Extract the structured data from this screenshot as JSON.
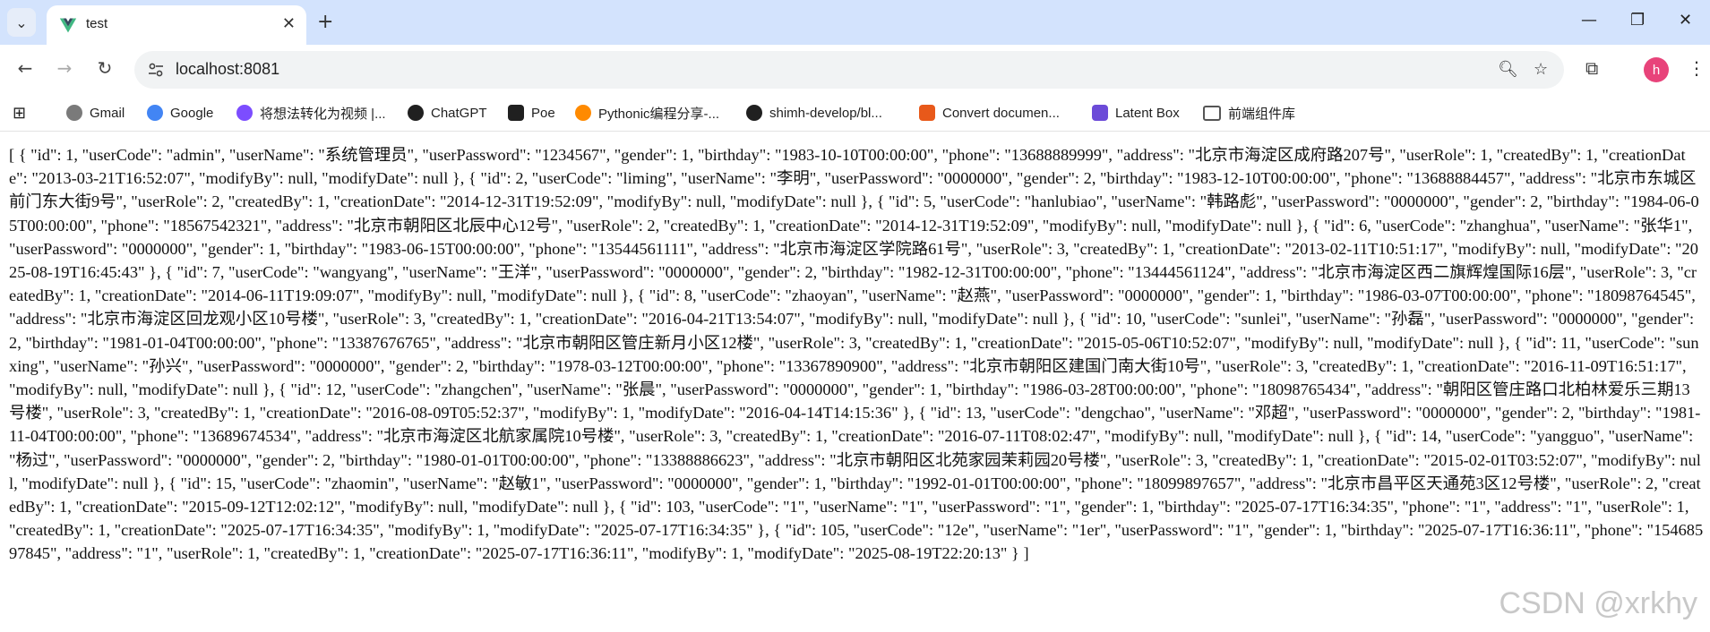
{
  "browser": {
    "tab_title": "test",
    "new_tab_glyph": "+",
    "url": "localhost:8081",
    "profile_initial": "h",
    "icons": [
      "tab-search-icon",
      "vue-logo-icon",
      "close-icon",
      "back-icon",
      "forward-icon",
      "reload-icon",
      "site-info-icon",
      "zoom-icon",
      "star-icon",
      "extensions-icon",
      "menu-icon",
      "apps-icon"
    ]
  },
  "bookmarks": [
    {
      "label": "Gmail",
      "color": "#ea4335"
    },
    {
      "label": "Google",
      "color": "#4285f4"
    },
    {
      "label": "将想法转化为视频 |...",
      "color": "#7c4dff"
    },
    {
      "label": "ChatGPT",
      "color": "#202020"
    },
    {
      "label": "Poe",
      "color": "#202020"
    },
    {
      "label": "Pythonic编程分享-...",
      "color": "#ff8a00"
    },
    {
      "label": "shimh-develop/bl...",
      "color": "#202020"
    },
    {
      "label": "Convert documen...",
      "color": "#e8591a"
    },
    {
      "label": "Latent Box",
      "color": "#6c4bd8"
    },
    {
      "label": "前端组件库",
      "color": "#666666"
    }
  ],
  "content": {
    "json_text": "[ { \"id\": 1, \"userCode\": \"admin\", \"userName\": \"系统管理员\", \"userPassword\": \"1234567\", \"gender\": 1, \"birthday\": \"1983-10-10T00:00:00\", \"phone\": \"13688889999\", \"address\": \"北京市海淀区成府路207号\", \"userRole\": 1, \"createdBy\": 1, \"creationDate\": \"2013-03-21T16:52:07\", \"modifyBy\": null, \"modifyDate\": null }, { \"id\": 2, \"userCode\": \"liming\", \"userName\": \"李明\", \"userPassword\": \"0000000\", \"gender\": 2, \"birthday\": \"1983-12-10T00:00:00\", \"phone\": \"13688884457\", \"address\": \"北京市东城区前门东大街9号\", \"userRole\": 2, \"createdBy\": 1, \"creationDate\": \"2014-12-31T19:52:09\", \"modifyBy\": null, \"modifyDate\": null }, { \"id\": 5, \"userCode\": \"hanlubiao\", \"userName\": \"韩路彪\", \"userPassword\": \"0000000\", \"gender\": 2, \"birthday\": \"1984-06-05T00:00:00\", \"phone\": \"18567542321\", \"address\": \"北京市朝阳区北辰中心12号\", \"userRole\": 2, \"createdBy\": 1, \"creationDate\": \"2014-12-31T19:52:09\", \"modifyBy\": null, \"modifyDate\": null }, { \"id\": 6, \"userCode\": \"zhanghua\", \"userName\": \"张华1\", \"userPassword\": \"0000000\", \"gender\": 1, \"birthday\": \"1983-06-15T00:00:00\", \"phone\": \"13544561111\", \"address\": \"北京市海淀区学院路61号\", \"userRole\": 3, \"createdBy\": 1, \"creationDate\": \"2013-02-11T10:51:17\", \"modifyBy\": null, \"modifyDate\": \"2025-08-19T16:45:43\" }, { \"id\": 7, \"userCode\": \"wangyang\", \"userName\": \"王洋\", \"userPassword\": \"0000000\", \"gender\": 2, \"birthday\": \"1982-12-31T00:00:00\", \"phone\": \"13444561124\", \"address\": \"北京市海淀区西二旗辉煌国际16层\", \"userRole\": 3, \"createdBy\": 1, \"creationDate\": \"2014-06-11T19:09:07\", \"modifyBy\": null, \"modifyDate\": null }, { \"id\": 8, \"userCode\": \"zhaoyan\", \"userName\": \"赵燕\", \"userPassword\": \"0000000\", \"gender\": 1, \"birthday\": \"1986-03-07T00:00:00\", \"phone\": \"18098764545\", \"address\": \"北京市海淀区回龙观小区10号楼\", \"userRole\": 3, \"createdBy\": 1, \"creationDate\": \"2016-04-21T13:54:07\", \"modifyBy\": null, \"modifyDate\": null }, { \"id\": 10, \"userCode\": \"sunlei\", \"userName\": \"孙磊\", \"userPassword\": \"0000000\", \"gender\": 2, \"birthday\": \"1981-01-04T00:00:00\", \"phone\": \"13387676765\", \"address\": \"北京市朝阳区管庄新月小区12楼\", \"userRole\": 3, \"createdBy\": 1, \"creationDate\": \"2015-05-06T10:52:07\", \"modifyBy\": null, \"modifyDate\": null }, { \"id\": 11, \"userCode\": \"sunxing\", \"userName\": \"孙兴\", \"userPassword\": \"0000000\", \"gender\": 2, \"birthday\": \"1978-03-12T00:00:00\", \"phone\": \"13367890900\", \"address\": \"北京市朝阳区建国门南大街10号\", \"userRole\": 3, \"createdBy\": 1, \"creationDate\": \"2016-11-09T16:51:17\", \"modifyBy\": null, \"modifyDate\": null }, { \"id\": 12, \"userCode\": \"zhangchen\", \"userName\": \"张晨\", \"userPassword\": \"0000000\", \"gender\": 1, \"birthday\": \"1986-03-28T00:00:00\", \"phone\": \"18098765434\", \"address\": \"朝阳区管庄路口北柏林爱乐三期13号楼\", \"userRole\": 3, \"createdBy\": 1, \"creationDate\": \"2016-08-09T05:52:37\", \"modifyBy\": 1, \"modifyDate\": \"2016-04-14T14:15:36\" }, { \"id\": 13, \"userCode\": \"dengchao\", \"userName\": \"邓超\", \"userPassword\": \"0000000\", \"gender\": 2, \"birthday\": \"1981-11-04T00:00:00\", \"phone\": \"13689674534\", \"address\": \"北京市海淀区北航家属院10号楼\", \"userRole\": 3, \"createdBy\": 1, \"creationDate\": \"2016-07-11T08:02:47\", \"modifyBy\": null, \"modifyDate\": null }, { \"id\": 14, \"userCode\": \"yangguo\", \"userName\": \"杨过\", \"userPassword\": \"0000000\", \"gender\": 2, \"birthday\": \"1980-01-01T00:00:00\", \"phone\": \"13388886623\", \"address\": \"北京市朝阳区北苑家园茉莉园20号楼\", \"userRole\": 3, \"createdBy\": 1, \"creationDate\": \"2015-02-01T03:52:07\", \"modifyBy\": null, \"modifyDate\": null }, { \"id\": 15, \"userCode\": \"zhaomin\", \"userName\": \"赵敏1\", \"userPassword\": \"0000000\", \"gender\": 1, \"birthday\": \"1992-01-01T00:00:00\", \"phone\": \"18099897657\", \"address\": \"北京市昌平区天通苑3区12号楼\", \"userRole\": 2, \"createdBy\": 1, \"creationDate\": \"2015-09-12T12:02:12\", \"modifyBy\": null, \"modifyDate\": null }, { \"id\": 103, \"userCode\": \"1\", \"userName\": \"1\", \"userPassword\": \"1\", \"gender\": 1, \"birthday\": \"2025-07-17T16:34:35\", \"phone\": \"1\", \"address\": \"1\", \"userRole\": 1, \"createdBy\": 1, \"creationDate\": \"2025-07-17T16:34:35\", \"modifyBy\": 1, \"modifyDate\": \"2025-07-17T16:34:35\" }, { \"id\": 105, \"userCode\": \"12e\", \"userName\": \"1er\", \"userPassword\": \"1\", \"gender\": 1, \"birthday\": \"2025-07-17T16:36:11\", \"phone\": \"15468597845\", \"address\": \"1\", \"userRole\": 1, \"createdBy\": 1, \"creationDate\": \"2025-07-17T16:36:11\", \"modifyBy\": 1, \"modifyDate\": \"2025-08-19T22:20:13\" } ]",
    "watermark": "CSDN @xrkhy"
  }
}
